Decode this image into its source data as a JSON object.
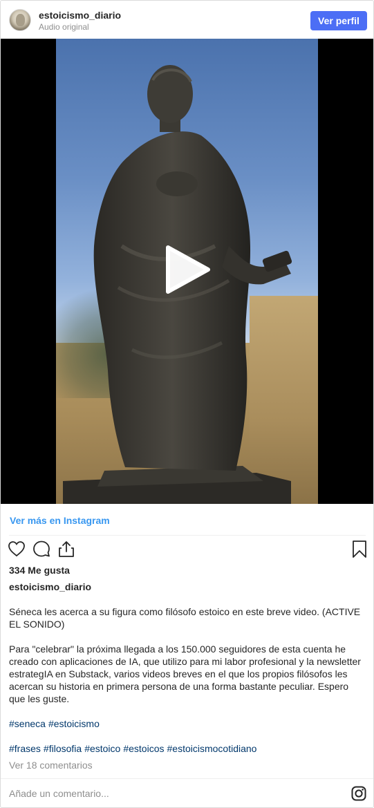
{
  "header": {
    "username": "estoicismo_diario",
    "audio_label": "Audio original",
    "profile_button": "Ver perfil"
  },
  "media": {
    "icon": "play-icon",
    "subject": "video"
  },
  "view_more_link": "Ver más en Instagram",
  "actions": {
    "like_icon": "heart-icon",
    "comment_icon": "comment-icon",
    "share_icon": "share-icon",
    "save_icon": "bookmark-icon"
  },
  "likes": "334 Me gusta",
  "caption": {
    "username": "estoicismo_diario",
    "paragraphs": [
      "Séneca les acerca a su figura como filósofo estoico en este breve video. (ACTIVE EL SONIDO)",
      "Para \"celebrar\" la próxima llegada a los 150.000 seguidores de esta cuenta he creado con aplicaciones de IA, que utilizo para mi labor profesional y la newsletter estrategIA en Substack, varios videos breves en el que los propios filósofos les acercan su historia en primera persona de una forma bastante peculiar. Espero que les guste."
    ],
    "tags_line1": [
      "#seneca",
      "#estoicismo"
    ],
    "tags_line2": [
      "#frases",
      "#filosofia",
      "#estoico",
      "#estoicos",
      "#estoicismocotidiano"
    ]
  },
  "comments_link": "Ver 18 comentarios",
  "add_comment_placeholder": "Añade un comentario...",
  "footer_icon": "instagram-icon",
  "colors": {
    "accent": "#4c6ef5",
    "link": "#3897f0",
    "hashtag": "#00376b",
    "muted": "#8e8e8e"
  }
}
